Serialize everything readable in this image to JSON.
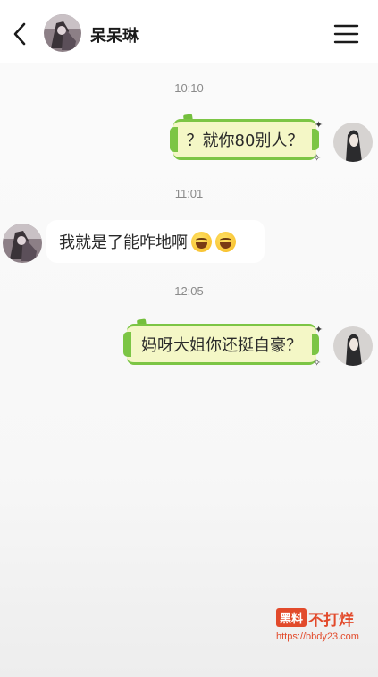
{
  "header": {
    "contact_name": "呆呆琳",
    "back_icon": "chevron-left-icon",
    "menu_icon": "hamburger-menu-icon"
  },
  "messages": [
    {
      "timestamp": "10:10",
      "sender": "me",
      "text": "？就你80别人？"
    },
    {
      "timestamp": "11:01",
      "sender": "contact",
      "text": "我就是了能咋地啊",
      "emojis": [
        "laughing-emoji",
        "laughing-emoji"
      ]
    },
    {
      "timestamp": "12:05",
      "sender": "me",
      "text": "妈呀大姐你还挺自豪？"
    }
  ],
  "watermark": {
    "badge": "黑料",
    "name": "不打烊",
    "url": "https://bbdy23.com"
  },
  "colors": {
    "bubble_fill": "#f4f7c6",
    "bubble_border": "#7cc545",
    "watermark": "#e24a2b"
  }
}
